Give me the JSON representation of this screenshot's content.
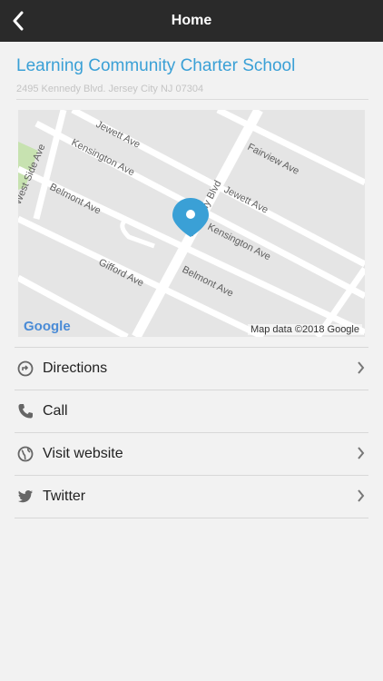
{
  "topbar": {
    "title": "Home"
  },
  "school": {
    "name": "Learning Community Charter School",
    "address": "2495 Kennedy Blvd. Jersey City NJ 07304"
  },
  "map": {
    "streets": [
      "Jewett Ave",
      "Kensington Ave",
      "West Side Ave",
      "Belmont Ave",
      "Gifford Ave",
      "Fairview Ave",
      "Jewett Ave",
      "Kennedy Blvd",
      "Kensington Ave",
      "Belmont Ave"
    ],
    "logo": "Google",
    "attribution": "Map data ©2018 Google",
    "pin_color": "#3aa0d6"
  },
  "actions": [
    {
      "label": "Directions",
      "icon": "directions-icon",
      "chevron": true
    },
    {
      "label": "Call",
      "icon": "phone-icon",
      "chevron": false
    },
    {
      "label": "Visit website",
      "icon": "globe-icon",
      "chevron": true
    },
    {
      "label": "Twitter",
      "icon": "twitter-icon",
      "chevron": true
    }
  ],
  "colors": {
    "accent": "#3aa0d6",
    "topbar": "#2a2a2a",
    "background": "#f2f2f2"
  }
}
